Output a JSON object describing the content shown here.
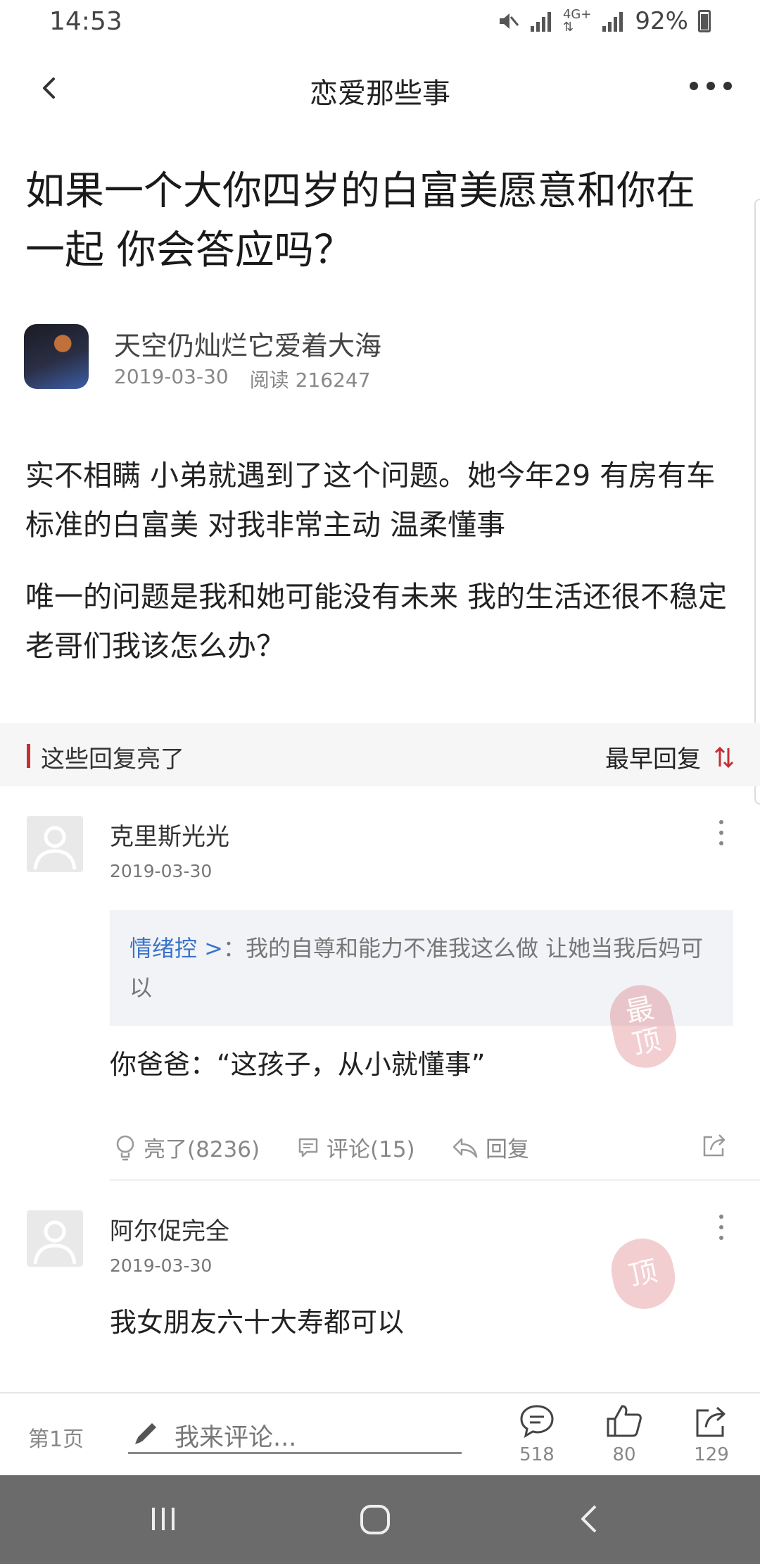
{
  "status_bar": {
    "time": "14:53",
    "battery": "92%"
  },
  "header": {
    "title": "恋爱那些事"
  },
  "post": {
    "title": "如果一个大你四岁的白富美愿意和你在一起 你会答应吗？",
    "author": "天空仍灿烂它爱着大海",
    "date": "2019-03-30",
    "reads": "阅读 216247",
    "paragraphs": [
      "实不相瞒 小弟就遇到了这个问题。她今年29 有房有车 标准的白富美 对我非常主动 温柔懂事",
      "唯一的问题是我和她可能没有未来 我的生活还很不稳定 老哥们我该怎么办？"
    ]
  },
  "section": {
    "label": "这些回复亮了",
    "sort_label": "最早回复"
  },
  "replies": [
    {
      "user": "克里斯光光",
      "date": "2019-03-30",
      "quote_user": "情绪控 >",
      "quote_text": "：我的自尊和能力不准我这么做  让她当我后妈可以",
      "text": "你爸爸：“这孩子，从小就懂事”",
      "stamp": "最顶",
      "like_label": "亮了(8236)",
      "comment_label": "评论(15)",
      "reply_label": "回复"
    },
    {
      "user": "阿尔促完全",
      "date": "2019-03-30",
      "text": "我女朋友六十大寿都可以",
      "stamp": "顶"
    }
  ],
  "bottom_bar": {
    "page_label": "第1页",
    "comment_placeholder": "我来评论...",
    "comments_count": "518",
    "likes_count": "80",
    "shares_count": "129"
  },
  "icons": {
    "back": "chevron-left-icon",
    "more": "more-horizontal-icon",
    "sort": "sort-arrows-icon",
    "like": "lightbulb-icon",
    "comment": "comment-bubble-icon",
    "reply": "reply-arrow-icon",
    "share": "share-icon",
    "pencil": "pencil-icon",
    "thumb": "thumbs-up-icon"
  },
  "colors": {
    "accent": "#c62f32",
    "link": "#3a73c9",
    "nav_bar": "#6b6b6b"
  }
}
